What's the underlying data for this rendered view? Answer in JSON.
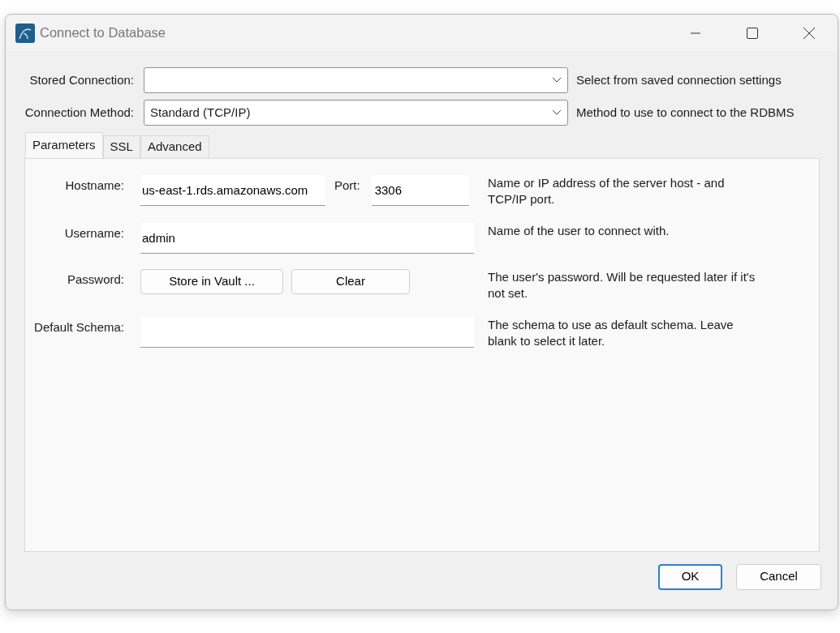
{
  "window": {
    "title": "Connect to Database"
  },
  "stored_connection": {
    "label": "Stored Connection:",
    "help": "Select from saved connection settings"
  },
  "connection_method": {
    "label": "Connection Method:",
    "value": "Standard (TCP/IP)",
    "help": "Method to use to connect to the RDBMS"
  },
  "tabs": [
    {
      "label": "Parameters",
      "selected": true
    },
    {
      "label": "SSL",
      "selected": false
    },
    {
      "label": "Advanced",
      "selected": false
    }
  ],
  "parameters": [
    {
      "kind": "host_port",
      "label": "Hostname:",
      "value": "us-east-1.rds.amazonaws.com",
      "port_label": "Port:",
      "port_value": "3306",
      "help": "Name or IP address of the server host - and TCP/IP port."
    },
    {
      "kind": "text",
      "label": "Username:",
      "value": "admin",
      "help": "Name of the user to connect with."
    },
    {
      "kind": "buttons",
      "label": "Password:",
      "buttons": [
        "Store in Vault ...",
        "Clear"
      ],
      "help": "The user's password. Will be requested later if it's not set."
    },
    {
      "kind": "text",
      "label": "Default Schema:",
      "help": "The schema to use as default schema. Leave blank to select it later."
    }
  ],
  "buttons": [
    {
      "label": "OK",
      "default": true
    },
    {
      "label": "Cancel",
      "default": false
    }
  ]
}
